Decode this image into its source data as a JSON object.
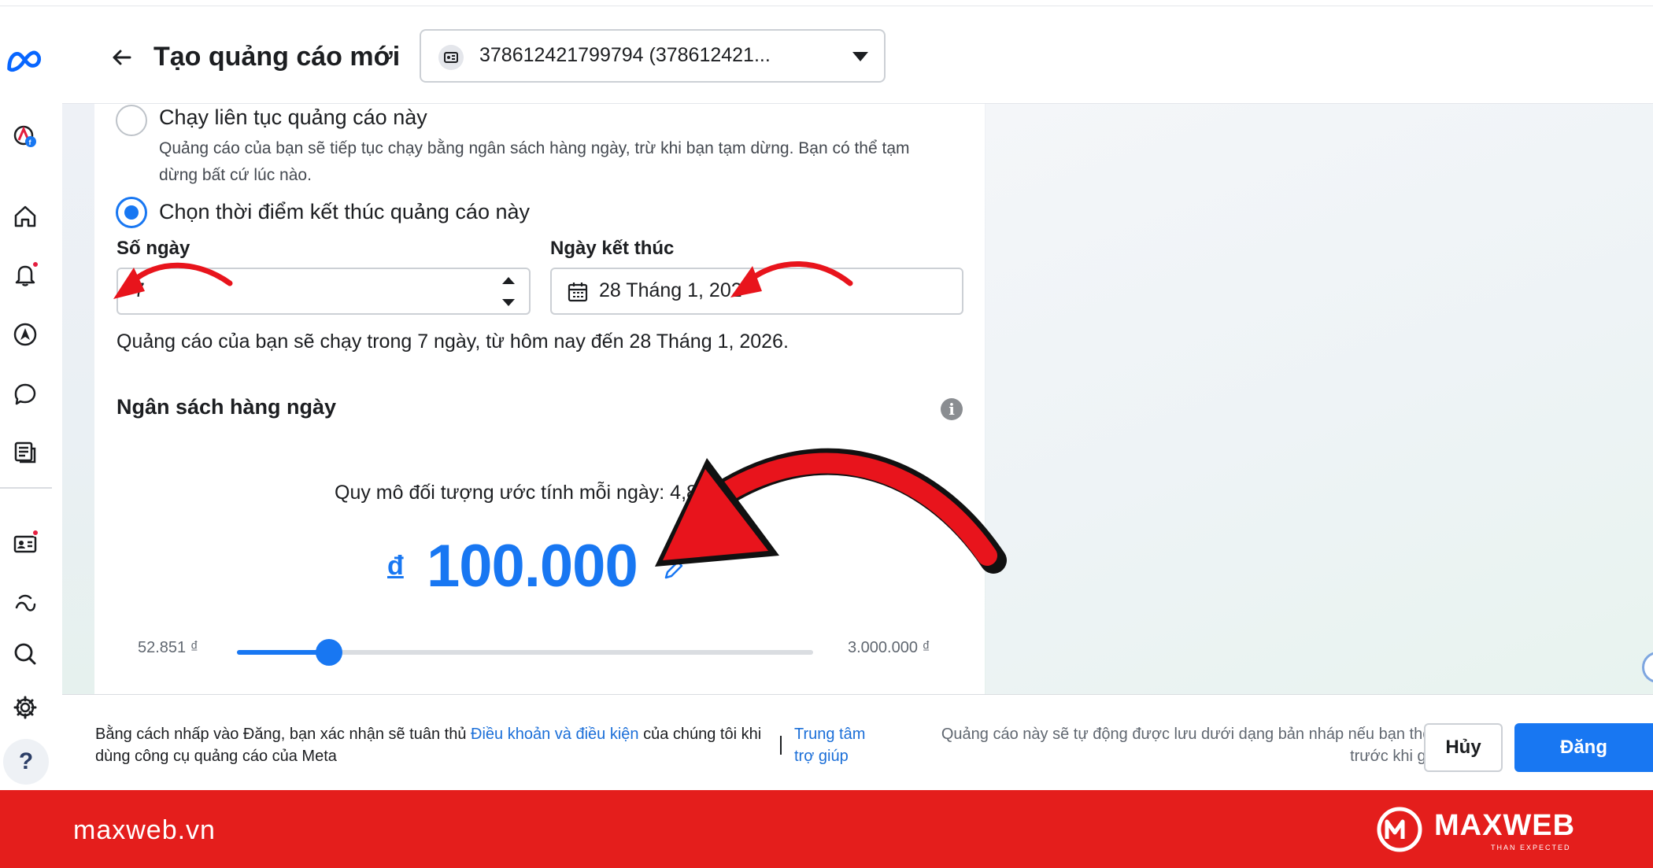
{
  "header": {
    "title": "Tạo quảng cáo mới",
    "account_label": "378612421799794 (378612421..."
  },
  "schedule": {
    "option_continuous_title": "Chạy liên tục quảng cáo này",
    "option_continuous_desc": "Quảng cáo của bạn sẽ tiếp tục chạy bằng ngân sách hàng ngày, trừ khi bạn tạm dừng. Bạn có thể tạm dừng bất cứ lúc nào.",
    "option_end_title": "Chọn thời điểm kết thúc quảng cáo này",
    "days_label": "Số ngày",
    "days_value": "7",
    "end_date_label": "Ngày kết thúc",
    "end_date_value": "28 Tháng 1, 202",
    "summary": "Quảng cáo của bạn sẽ chạy trong 7 ngày, từ hôm nay đến 28 Tháng 1, 2026."
  },
  "budget": {
    "title": "Ngân sách hàng ngày",
    "audience_estimate": "Quy mô đối tượng ước tính mỗi ngày: 4,8K - 1",
    "currency_symbol": "đ",
    "amount": "100.000",
    "min_label": "52.851 ₫",
    "max_label": "3.000.000 ₫",
    "slider_fraction": 0.16
  },
  "footer": {
    "terms_prefix": "Bằng cách nhấp vào Đăng, bạn xác nhận sẽ tuân thủ ",
    "terms_link": "Điều khoản và điều kiện",
    "terms_suffix": " của chúng tôi khi dùng công cụ quảng cáo của Meta",
    "help_link": "Trung tâm trợ giúp",
    "draft_note": "Quảng cáo này sẽ tự động được lưu dưới dạng bản nháp nếu bạn thoát trước khi gửi.",
    "cancel_label": "Hủy",
    "publish_label": "Đăng"
  },
  "band": {
    "site": "maxweb.vn",
    "logo_text": "MAXWEB",
    "logo_tagline": "THAN EXPECTED"
  },
  "help_bubble": "?",
  "colors": {
    "accent": "#1877f2",
    "brand_band": "#e41e1c",
    "annotation_arrow": "#e8141c"
  }
}
